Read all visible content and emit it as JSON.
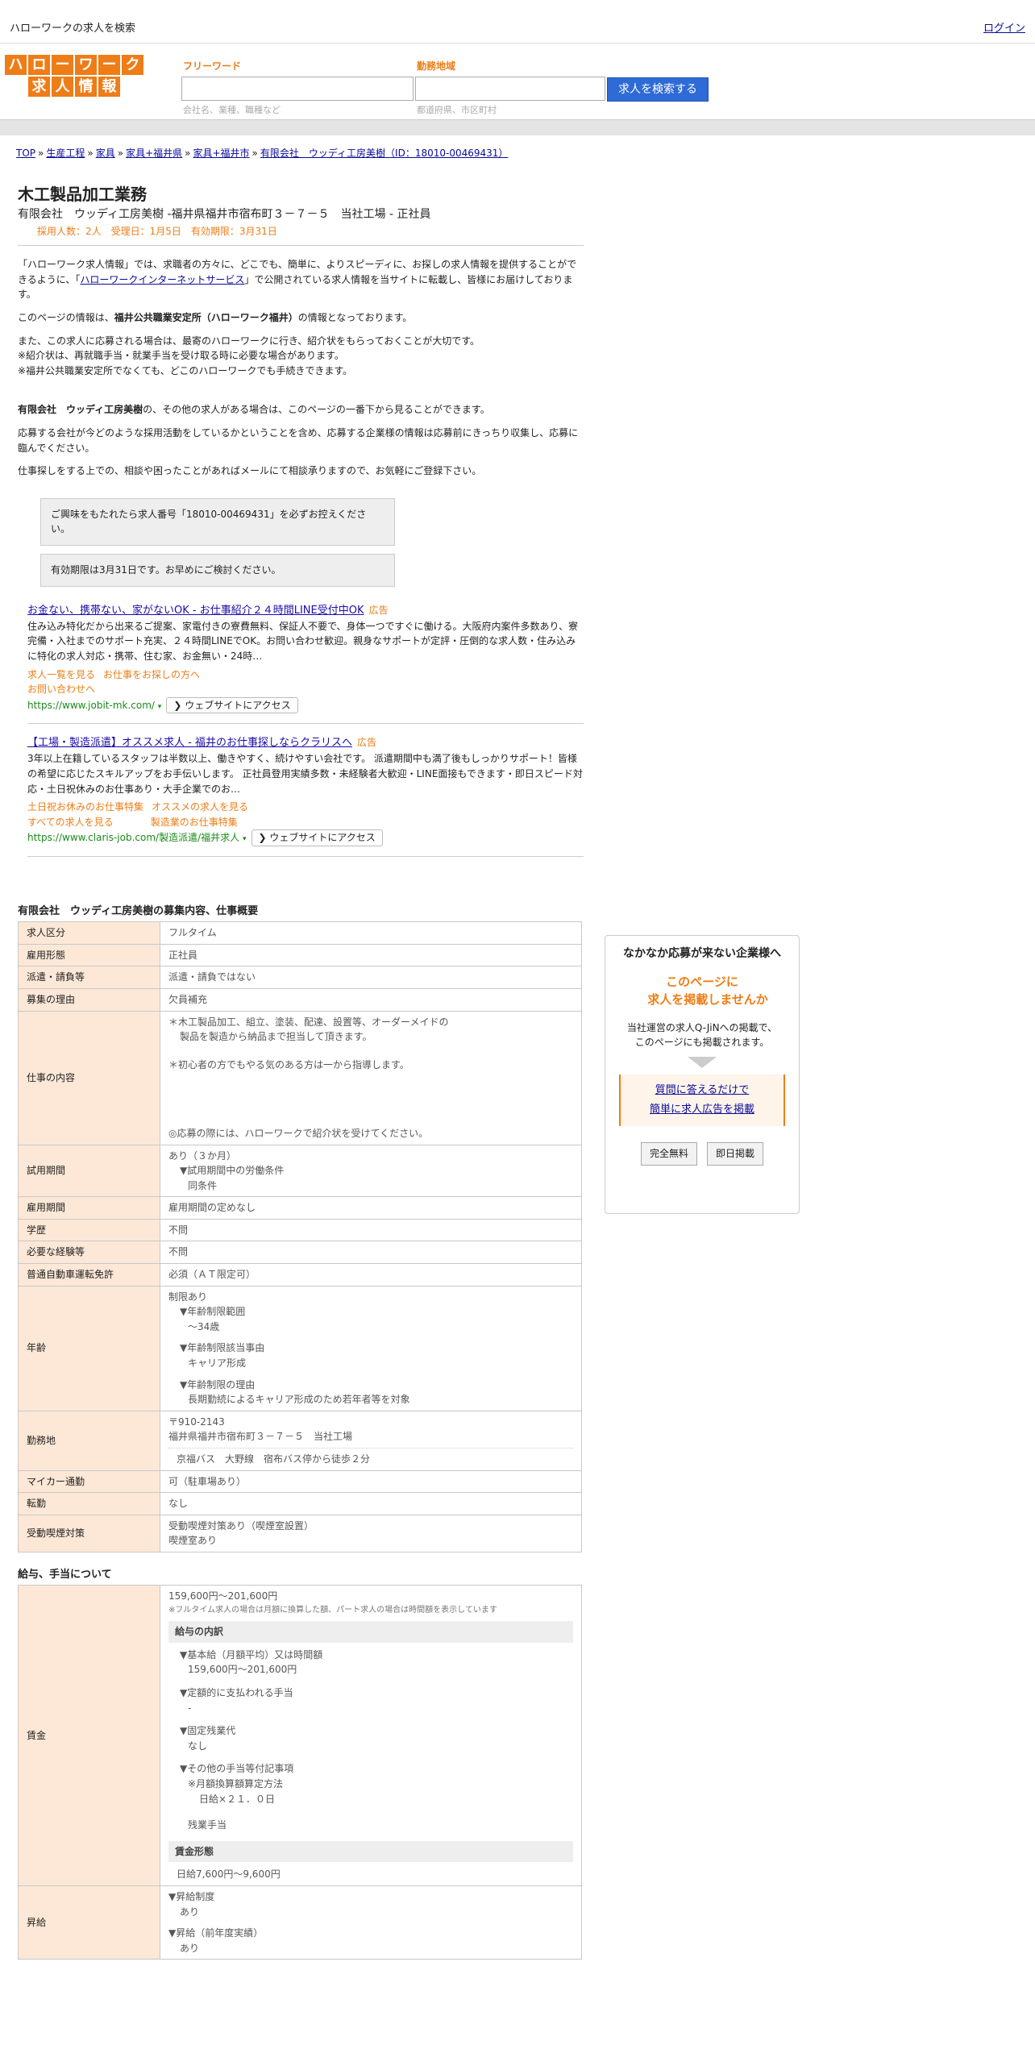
{
  "topbar": {
    "site_search": "ハローワークの求人を検索",
    "login": "ログイン"
  },
  "logo": {
    "line1": [
      "ハ",
      "ロ",
      "ー",
      "ワ",
      "ー",
      "ク"
    ],
    "line2": [
      "求",
      "人",
      "情",
      "報"
    ]
  },
  "search": {
    "keyword_label": "フリーワード",
    "keyword_hint": "会社名、業種、職種など",
    "area_label": "勤務地域",
    "area_hint": "都道府県、市区町村",
    "button": "求人を検索する"
  },
  "breadcrumb": [
    "TOP",
    "生産工程",
    "家具",
    "家具+福井県",
    "家具+福井市",
    "有限会社　ウッディ工房美樹（ID：18010-00469431）"
  ],
  "job": {
    "title": "木工製品加工業務",
    "subtitle": "有限会社　ウッディ工房美樹 -福井県福井市宿布町３－７－５　当社工場 - 正社員",
    "meta": "採用人数：2人　受理日：1月5日　有効期限：3月31日"
  },
  "intro": {
    "p1a": "「ハローワーク求人情報」では、求職者の方々に、どこでも、簡単に、よりスピーディに、お探しの求人情報を提供することができるように、「",
    "p1link": "ハローワークインターネットサービス",
    "p1b": "」で公開されている求人情報を当サイトに転載し、皆様にお届けしております。",
    "p2a": "このページの情報は、",
    "p2b": "福井公共職業安定所（ハローワーク福井）",
    "p2c": "の情報となっております。",
    "p3": "また、この求人に応募される場合は、最寄のハローワークに行き、紹介状をもらっておくことが大切です。",
    "p4": "※紹介状は、再就職手当・就業手当を受け取る時に必要な場合があります。",
    "p5": "※福井公共職業安定所でなくても、どこのハローワークでも手続きできます。",
    "p6a": "有限会社　ウッディ工房美樹",
    "p6b": "の、その他の求人がある場合は、このページの一番下から見ることができます。",
    "p7": "応募する会社が今どのような採用活動をしているかということを含め、応募する企業様の情報は応募前にきっちり収集し、応募に臨んでください。",
    "p8": "仕事探しをする上での、相談や困ったことがあればメールにて相談承りますので、お気軽にご登録下さい。",
    "note1": "ご興味をもたれたら求人番号「18010-00469431」を必ずお控えください。",
    "note2": "有効期限は3月31日です。お早めにご検討ください。"
  },
  "ads": [
    {
      "title": "お金ない、携帯ない、家がないOK - お仕事紹介２４時間LINE受付中OK",
      "label": "広告",
      "text": "住み込み特化だから出来るご提案、家電付きの寮費無料、保証人不要で、身体一つですぐに働ける。大阪府内案件多数あり、寮完備・入社までのサポート充実、２４時間LINEでOK。お問い合わせ歓迎。親身なサポートが定評・圧倒的な求人数・住み込みに特化の求人対応・携帯、住む家、お金無い・24時…",
      "links": [
        "求人一覧を見る",
        "お仕事をお探しの方へ",
        "お問い合わせへ"
      ],
      "url": "https://www.jobit-mk.com/",
      "visit": "❯ ウェブサイトにアクセス"
    },
    {
      "title": "【工場・製造派遣】オススメ求人 - 福井のお仕事探しならクラリスへ",
      "label": "広告",
      "text": "3年以上在籍しているスタッフは半数以上、働きやすく、続けやすい会社です。 派遣期間中も満了後もしっかりサポート！皆様の希望に応じたスキルアップをお手伝いします。 正社員登用実績多数・未経験者大歓迎・LINE面接もできます・即日スピード対応・土日祝休みのお仕事あり・大手企業でのお…",
      "links": [
        "土日祝お休みのお仕事特集",
        "オススメの求人を見る",
        "すべての求人を見る",
        "製造業のお仕事特集"
      ],
      "url": "https://www.claris-job.com/製造派遣/福井求人",
      "visit": "❯ ウェブサイトにアクセス"
    }
  ],
  "overview": {
    "title": "有限会社　ウッディ工房美樹の募集内容、仕事概要",
    "rows": {
      "kubun": [
        "求人区分",
        "フルタイム"
      ],
      "keitai": [
        "雇用形態",
        "正社員"
      ],
      "haken": [
        "派遣・請負等",
        "派遣・請負ではない"
      ],
      "riyu": [
        "募集の理由",
        "欠員補充"
      ],
      "naiyo_label": "仕事の内容",
      "naiyo1": "＊木工製品加工、組立、塗装、配達、設置等、オーダーメイドの",
      "naiyo2": "製品を製造から納品まで担当して頂きます。",
      "naiyo3": "＊初心者の方でもやる気のある方は一から指導します。",
      "naiyo4": "◎応募の際には、ハローワークで紹介状を受けてください。",
      "shiyo_label": "試用期間",
      "shiyo1": "あり（３か月）",
      "shiyo2": "▼試用期間中の労働条件",
      "shiyo3": "同条件",
      "kikan": [
        "雇用期間",
        "雇用期間の定めなし"
      ],
      "gakureki": [
        "学歴",
        "不問"
      ],
      "keiken": [
        "必要な経験等",
        "不問"
      ],
      "menkyo": [
        "普通自動車運転免許",
        "必須（ＡＴ限定可）"
      ],
      "nenrei_label": "年齢",
      "nenrei1": "制限あり",
      "nenrei2": "▼年齢制限範囲",
      "nenrei3": "〜34歳",
      "nenrei4": "▼年齢制限該当事由",
      "nenrei5": "キャリア形成",
      "nenrei6": "▼年齢制限の理由",
      "nenrei7": "長期勤続によるキャリア形成のため若年者等を対象",
      "kinmu_label": "勤務地",
      "kinmu1": "〒910-2143",
      "kinmu2": "福井県福井市宿布町３－７－５　当社工場",
      "kinmu3": "京福バス　大野線　宿布バス停から徒歩２分",
      "mycar": [
        "マイカー通勤",
        "可（駐車場あり）"
      ],
      "tenkin": [
        "転勤",
        "なし"
      ],
      "judo_label": "受動喫煙対策",
      "judo1": "受動喫煙対策あり（喫煙室設置）",
      "judo2": "喫煙室あり"
    }
  },
  "salary": {
    "title": "給与、手当について",
    "label": "賃金",
    "range": "159,600円〜201,600円",
    "note": "※フルタイム求人の場合は月額に換算した額、パート求人の場合は時間額を表示しています",
    "breakdown_head": "給与の内訳",
    "kihon1": "▼基本給（月額平均）又は時間額",
    "kihon2": "159,600円〜201,600円",
    "teigaku1": "▼定額的に支払われる手当",
    "teigaku2": "-",
    "kotei1": "▼固定残業代",
    "kotei2": "なし",
    "sonota1": "▼その他の手当等付記事項",
    "sonota2": "※月額換算額算定方法",
    "sonota3": "日給×２１．０日",
    "sonota4": "残業手当",
    "keitai_head": "賃金形態",
    "keitai_val": "日給7,600円〜9,600円",
    "shokyu_label": "昇給",
    "shokyu1": "▼昇給制度",
    "shokyu2": "あり",
    "shokyu3": "▼昇給（前年度実績）",
    "shokyu4": "あり"
  },
  "sidebar": {
    "title": "なかなか応募が来ない企業様へ",
    "promo1": "このページに",
    "promo2": "求人を掲載しませんか",
    "text1": "当社運営の求人Q-JiNへの掲載で、",
    "text2": "このページにも掲載されます。",
    "link1": "質問に答えるだけで",
    "link2": "簡単に求人広告を掲載",
    "btn1": "完全無料",
    "btn2": "即日掲載"
  }
}
